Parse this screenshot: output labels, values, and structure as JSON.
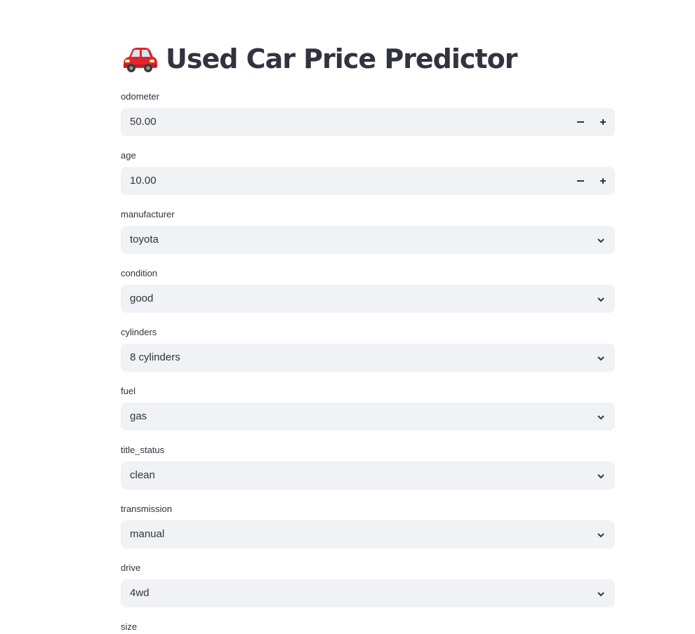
{
  "app": {
    "title": "Used Car Price Predictor",
    "title_icon": "red-car-icon"
  },
  "colors": {
    "input_bg": "#f0f2f6",
    "text": "#31333f",
    "car_red": "#e3242b"
  },
  "fields": {
    "odometer": {
      "label": "odometer",
      "value": "50.00",
      "minus_icon": "minus-icon",
      "plus_icon": "plus-icon"
    },
    "age": {
      "label": "age",
      "value": "10.00",
      "minus_icon": "minus-icon",
      "plus_icon": "plus-icon"
    },
    "manufacturer": {
      "label": "manufacturer",
      "value": "toyota",
      "icon": "chevron-down-icon"
    },
    "condition": {
      "label": "condition",
      "value": "good",
      "icon": "chevron-down-icon"
    },
    "cylinders": {
      "label": "cylinders",
      "value": "8 cylinders",
      "icon": "chevron-down-icon"
    },
    "fuel": {
      "label": "fuel",
      "value": "gas",
      "icon": "chevron-down-icon"
    },
    "title_status": {
      "label": "title_status",
      "value": "clean",
      "icon": "chevron-down-icon"
    },
    "transmission": {
      "label": "transmission",
      "value": "manual",
      "icon": "chevron-down-icon"
    },
    "drive": {
      "label": "drive",
      "value": "4wd",
      "icon": "chevron-down-icon"
    },
    "size": {
      "label": "size"
    }
  }
}
